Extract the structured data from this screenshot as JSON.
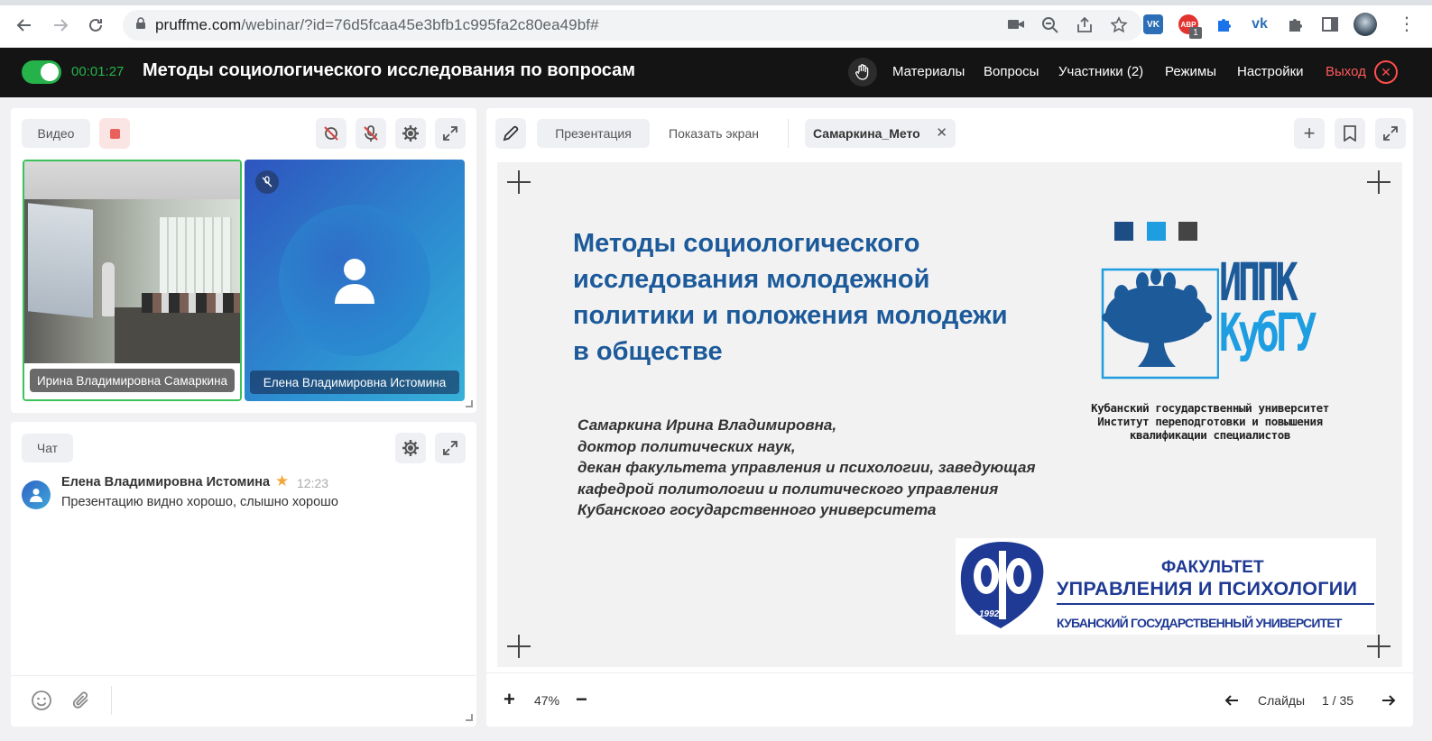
{
  "browser": {
    "url_host": "pruffme.com",
    "url_path": "/webinar/?id=76d5fcaa45e3bfb1c995fa2c80ea49bf#",
    "ext_badge": "1"
  },
  "header": {
    "timer": "00:01:27",
    "title": "Методы социологического исследования по вопросам",
    "menu": [
      "Материалы",
      "Вопросы",
      "Участники (2)",
      "Режимы",
      "Настройки"
    ],
    "exit_label": "Выход"
  },
  "video_panel": {
    "label": "Видео",
    "tiles": [
      {
        "name": "Ирина Владимировна Самаркина"
      },
      {
        "name": "Елена Владимировна Истомина"
      }
    ]
  },
  "chat": {
    "label": "Чат",
    "messages": [
      {
        "author": "Елена Владимировна Истомина",
        "time": "12:23",
        "text": "Презентацию видно хорошо, слышно хорошо"
      }
    ]
  },
  "presentation": {
    "tab_presentation": "Презентация",
    "tab_share": "Показать экран",
    "file_tab": "Самаркина_Мето",
    "slide": {
      "title_lines": [
        "Методы социологического",
        "исследования молодежной",
        "политики и положения молодежи",
        "в обществе"
      ],
      "author_lines": [
        "Самаркина Ирина Владимировна,",
        "доктор политических наук,",
        "декан факультета управления и психологии, заведующая",
        "кафедрой политологии и политического управления",
        "Кубанского государственного университета"
      ],
      "logo_top": "ИППК",
      "logo_bottom": "КубГУ",
      "org_lines": [
        "Кубанский государственный университет",
        "Институт переподготовки и повышения",
        "квалификации специалистов"
      ],
      "fac_line1": "ФАКУЛЬТЕТ",
      "fac_line2": "УПРАВЛЕНИЯ И ПСИХОЛОГИИ",
      "fac_line3": "КУБАНСКИЙ ГОСУДАРСТВЕННЫЙ УНИВЕРСИТЕТ",
      "fac_year": "1992"
    },
    "zoom": "47%",
    "slides_label": "Слайды",
    "slide_counter": "1 / 35"
  },
  "colors": {
    "accent_green": "#26b24b",
    "exit_red": "#ff4d4d",
    "slide_title_blue": "#1c5a9a",
    "faculty_blue": "#1f3a94"
  }
}
